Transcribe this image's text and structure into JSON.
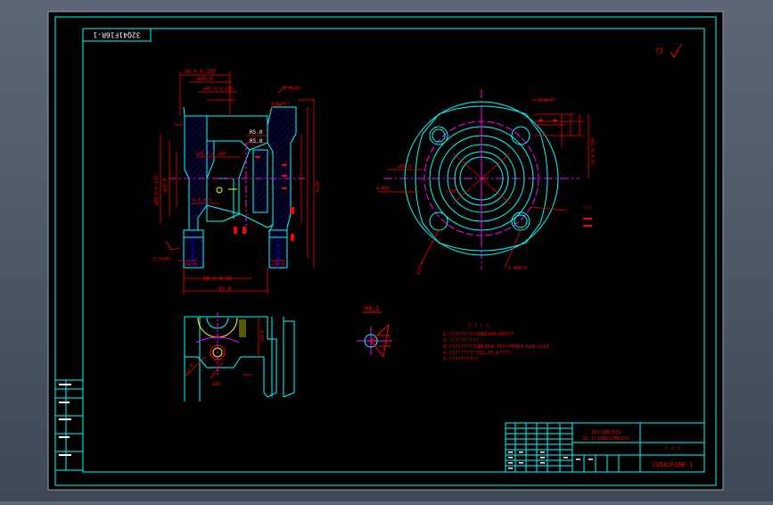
{
  "drawing": {
    "code_rotated": "32Q41F16R-1",
    "roughness_top": "?3",
    "main_view_dims": {
      "d1": "30.0-0.130",
      "d2": "ø48.0",
      "d3": "ø40.0-0.160",
      "d4": "1.0x45°",
      "d5": "1.0x45°",
      "d6": "R5.0",
      "d7": "R5.0",
      "d8": "ø28.5-0.160",
      "d9": "4.0-0.5",
      "d10": "ø80.0-0.228",
      "d11": "ø58.0",
      "d12": "ø130",
      "d13": "1.0x45°",
      "d14": "14.0",
      "d15": "16.0",
      "d16": "60.0-0.19",
      "d17": "95.0"
    },
    "top_view_dims": {
      "d1": "1.0x45°",
      "d2": "56.0-0.740",
      "d3": "ø85.0",
      "d4": "4-M16",
      "d5": "ø100",
      "d6": "ø12.0",
      "d7": "8-ø18.0",
      "d8": "???"
    },
    "bottom_view_dims": {
      "d1": "ø12.0",
      "d2": "ø10",
      "d3": "60.0"
    },
    "detail_label": "M4:1",
    "notes_title": "? ? ? ?",
    "notes": [
      "1.??????????GB2100—80???.",
      "2.??????????.",
      "3.?????????GB1804—79???HH14,h14,Js15.",
      "4.??????????25,25,6????.",
      "5.??????????"
    ],
    "title_block": {
      "material_line1": "ICr18Ni9Ti",
      "material_line2": "ZG  Cr18Ni12Mo2Ti",
      "company": "? ? ?",
      "drawing_number": "32Q41F16R-1"
    }
  },
  "colors": {
    "background": "#000000",
    "frame": "#00ffff",
    "part_outline": "#00ffff",
    "dimension": "#ff0000",
    "centerline": "#ff00ff",
    "hatch": "#0000ff",
    "highlight": "#ffff00",
    "text": "#ffffff"
  }
}
